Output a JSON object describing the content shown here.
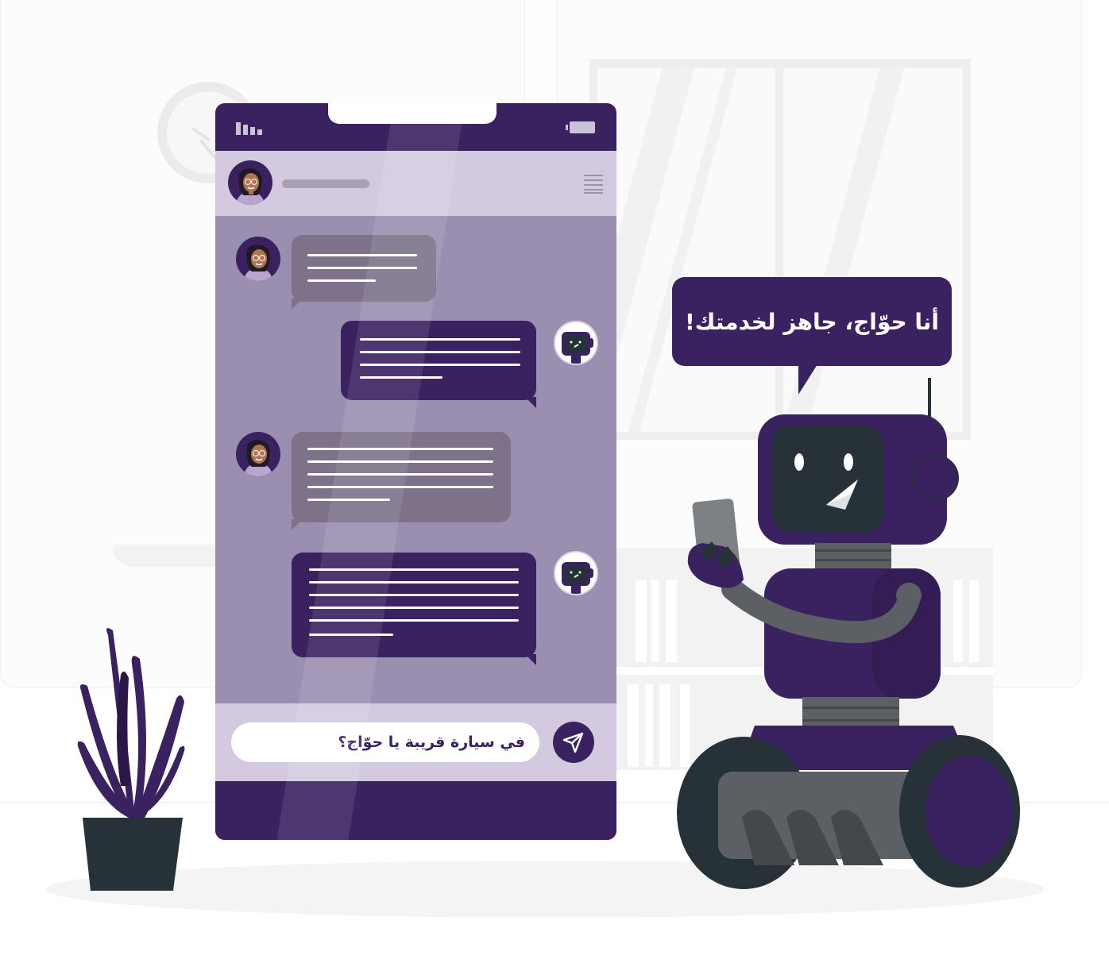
{
  "speech_bubble": {
    "text": "أنا حوّاج، جاهز لخدمتك!"
  },
  "chat": {
    "input_value": "في سيارة قريبة يا حوّاج؟",
    "send_icon": "send-icon",
    "menu_icon": "menu-icon"
  },
  "colors": {
    "primary": "#3a2160",
    "header": "#d3cadf",
    "chat_background": "#9a8fb0",
    "user_bubble": "#7d7289",
    "robot_screen": "#263238"
  }
}
